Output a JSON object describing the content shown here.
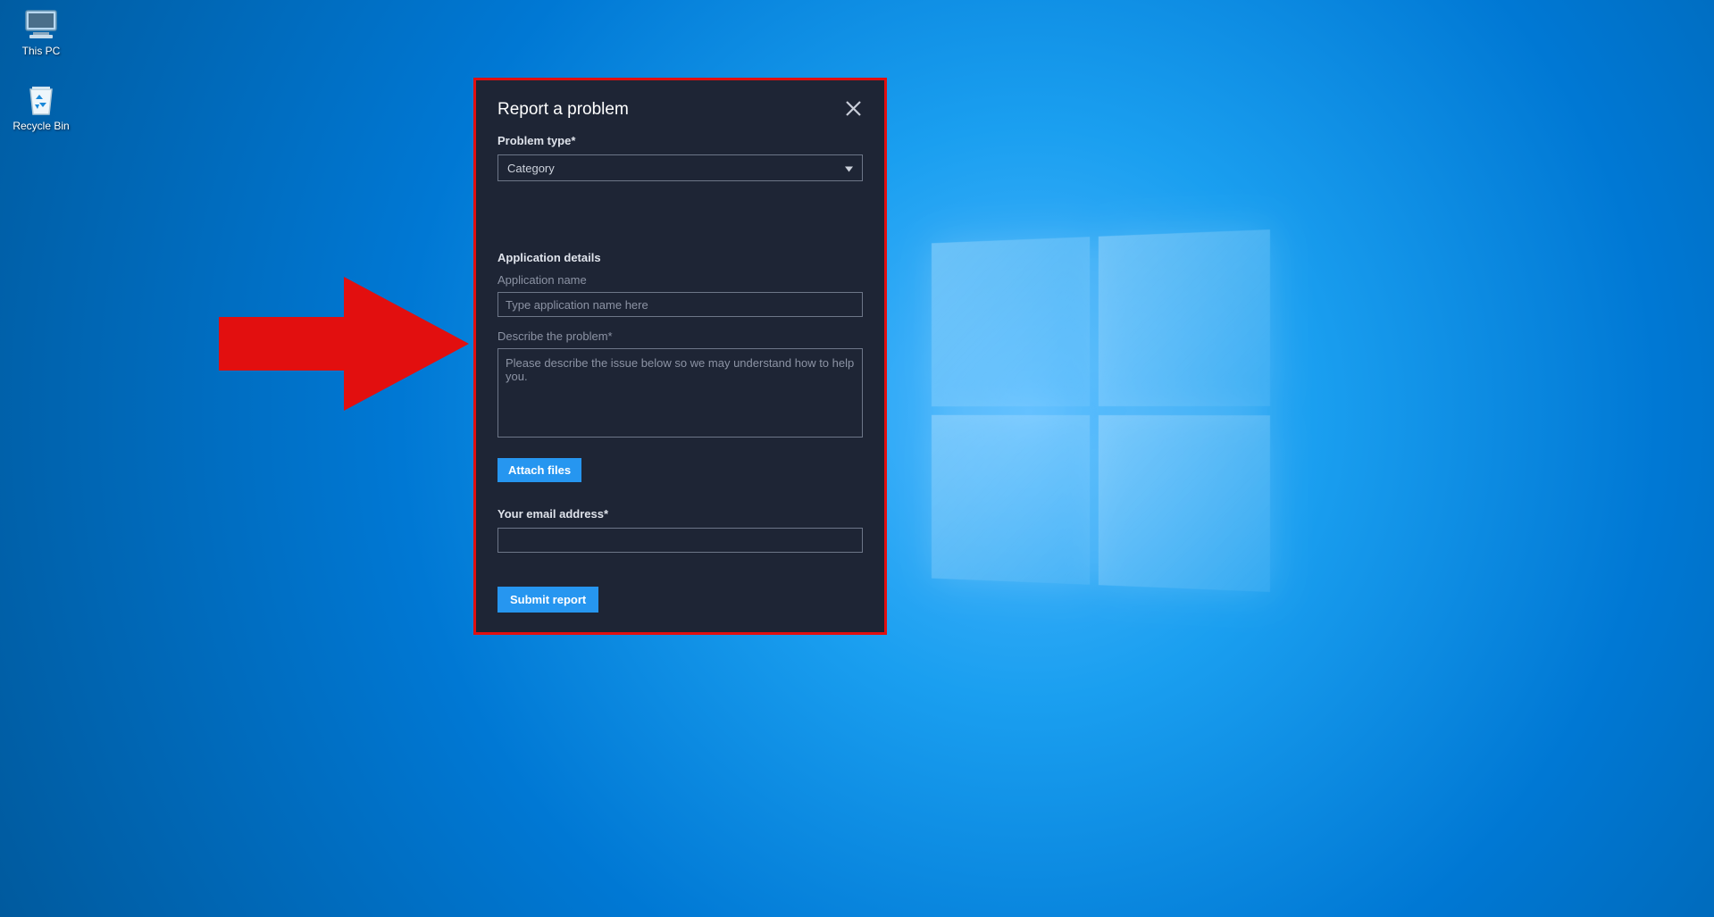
{
  "desktop": {
    "icons": [
      {
        "name": "this-pc",
        "label": "This PC"
      },
      {
        "name": "recycle-bin",
        "label": "Recycle Bin"
      }
    ]
  },
  "annotation": {
    "arrow_color": "#e20f0f"
  },
  "dialog": {
    "title": "Report a problem",
    "problem_type": {
      "label": "Problem type*",
      "selected": "Category"
    },
    "app_details": {
      "section_title": "Application details",
      "name_label": "Application name",
      "name_placeholder": "Type application name here",
      "name_value": "",
      "describe_label": "Describe the problem*",
      "describe_placeholder": "Please describe the issue below so we may understand how to help you.",
      "describe_value": ""
    },
    "attach_button": "Attach files",
    "email": {
      "label": "Your email address*",
      "value": ""
    },
    "submit_button": "Submit report"
  }
}
